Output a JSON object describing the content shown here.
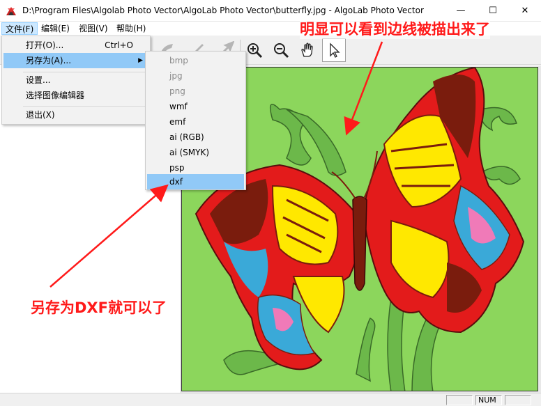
{
  "window": {
    "title": "D:\\Program Files\\Algolab Photo Vector\\AlgoLab Photo Vector\\butterfly.jpg - AlgoLab Photo Vector",
    "minimize_glyph": "—",
    "maximize_glyph": "☐",
    "close_glyph": "✕"
  },
  "menubar": {
    "items": [
      "文件(F)",
      "编辑(E)",
      "视图(V)",
      "帮助(H)"
    ]
  },
  "file_menu": {
    "items": [
      {
        "label": "打开(O)...",
        "shortcut": "Ctrl+O"
      },
      {
        "label": "另存为(A)...",
        "arrow": "▶"
      },
      {
        "label": "设置..."
      },
      {
        "label": "选择图像编辑器"
      },
      {
        "label": "退出(X)"
      }
    ]
  },
  "saveas_menu": {
    "items": [
      {
        "label": "bmp",
        "disabled": true
      },
      {
        "label": "jpg",
        "disabled": true
      },
      {
        "label": "png",
        "disabled": true
      },
      {
        "label": "wmf",
        "disabled": false
      },
      {
        "label": "emf",
        "disabled": false
      },
      {
        "label": "ai (RGB)",
        "disabled": false
      },
      {
        "label": "ai (SMYK)",
        "disabled": false
      },
      {
        "label": "psp",
        "disabled": false
      },
      {
        "label": "dxf",
        "disabled": false,
        "highlighted": true
      }
    ]
  },
  "toolbar": {
    "icons": [
      "vector-icon",
      "brush-icon",
      "export-icon",
      "zoom-in-icon",
      "zoom-out-icon",
      "hand-icon",
      "pointer-icon"
    ]
  },
  "statusbar": {
    "num": "NUM"
  },
  "annotations": {
    "top": "明显可以看到边线被描出来了",
    "bottom": "另存为DXF就可以了"
  },
  "colors": {
    "annotation": "#ff1a1a",
    "highlight": "#91c9f7",
    "canvas_bg": "#8cd65c",
    "butterfly_red": "#e31b1b",
    "butterfly_yellow": "#ffe800",
    "butterfly_brown": "#7a1c0d",
    "butterfly_blue": "#3aa9d8",
    "butterfly_pink": "#f07ab8",
    "leaf_green": "#6cb84a"
  }
}
